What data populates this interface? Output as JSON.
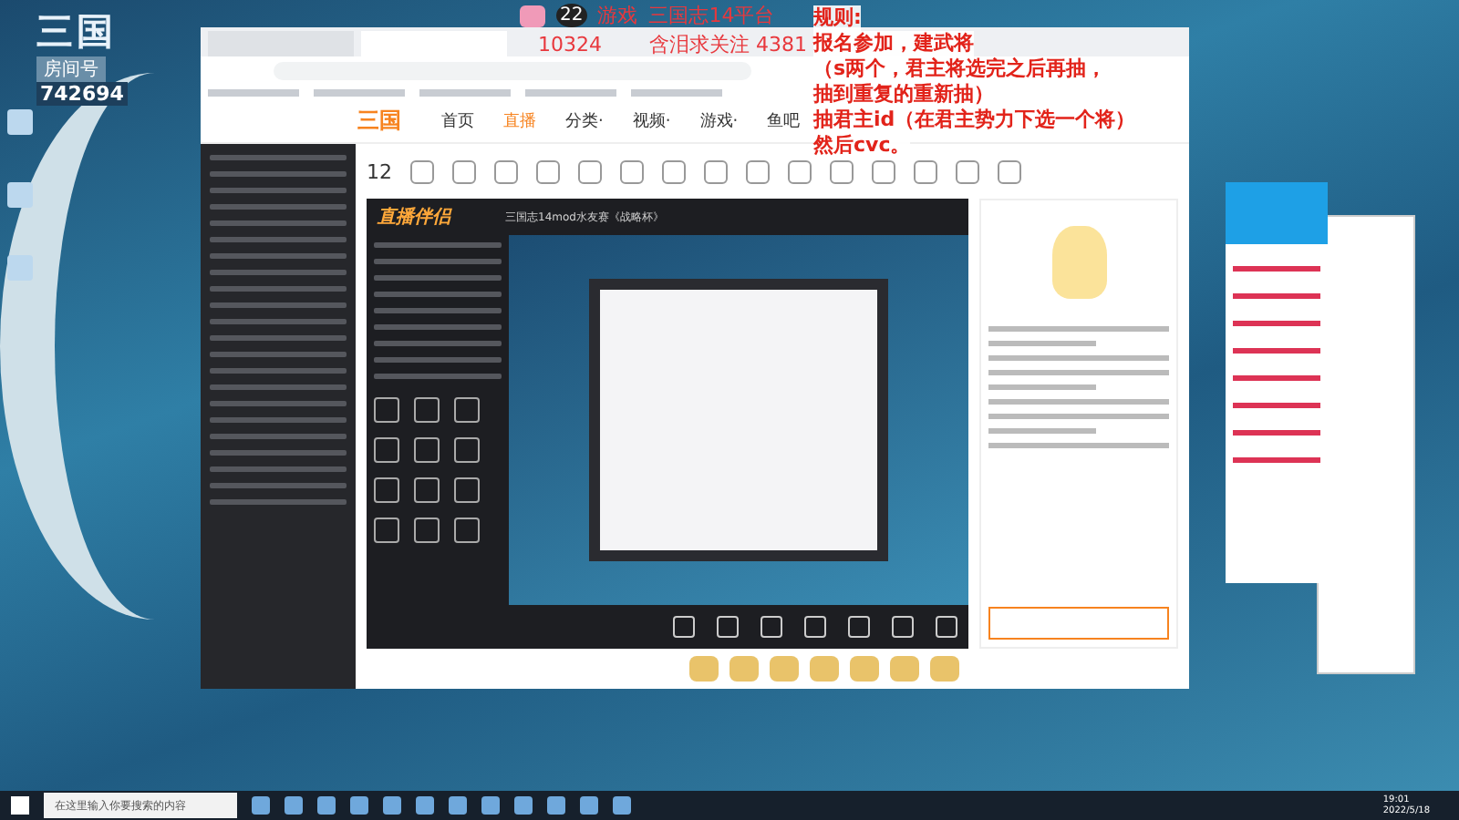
{
  "overlay": {
    "logo": "三国",
    "room_label": "房间号",
    "room_id": "742694",
    "fans": "10324",
    "level": "22",
    "category": "游戏",
    "title": "三国志14平台",
    "follow": "含泪求关注 4381",
    "rules": [
      "规则:",
      "报名参加，建武将",
      "（s两个，君主将选完之后再抽，",
      "抽到重复的重新抽）",
      "抽君主id（在君主势力下选一个将）",
      "然后cvc。"
    ]
  },
  "browser": {
    "logo": "三国",
    "nav": [
      {
        "label": "首页",
        "selected": false
      },
      {
        "label": "直播",
        "selected": true
      },
      {
        "label": "分类·",
        "selected": false
      },
      {
        "label": "视频·",
        "selected": false
      },
      {
        "label": "游戏·",
        "selected": false
      },
      {
        "label": "鱼吧",
        "selected": false
      }
    ],
    "counter": "12"
  },
  "studio": {
    "logo": "直播伴侣",
    "stream_title": "三国志14mod水友赛《战略杯》"
  },
  "taskbar": {
    "search_placeholder": "在这里输入你要搜索的内容",
    "time": "19:01",
    "date": "2022/5/18"
  }
}
